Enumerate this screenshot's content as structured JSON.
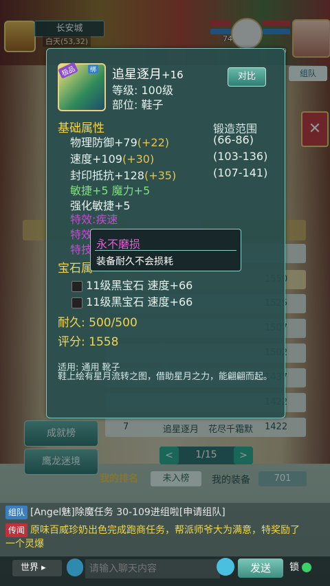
{
  "hud": {
    "city": "长安城",
    "time_coords": "白天(53,32)",
    "pet_level": "74",
    "player_level_partial": "9",
    "team_button": "组队"
  },
  "item": {
    "badge_left": "极品",
    "badge_right": "绑",
    "name": "追星逐月",
    "enhance": "+16",
    "level": "等级: 100级",
    "slot": "部位: 鞋子",
    "compare_button": "对比",
    "base_header": "基础属性",
    "forge_header": "锻造范围",
    "stats": [
      {
        "label": "物理防御+79",
        "bonus": "(+22)",
        "range": "(66-86)"
      },
      {
        "label": "速度+109",
        "bonus": "(+30)",
        "range": "(103-136)"
      },
      {
        "label": "封印抵抗+128",
        "bonus": "(+35)",
        "range": "(107-141)"
      }
    ],
    "green_line": "敏捷+5 魔力+5",
    "strengthen": "强化敏捷+5",
    "effect1": "特效:疾速",
    "effect2_partial": "特效",
    "effect3_partial": "特技",
    "gem_header": "宝石属",
    "gems": [
      "11级黑宝石 速度+66",
      "11级黑宝石 速度+66"
    ],
    "durability": "耐久: 500/500",
    "score": "评分: 1558",
    "apply": "适用: 通用 靴子",
    "desc": "鞋上绘有星月流转之图，借助星月之力，能翩翩而起。"
  },
  "tooltip": {
    "title": "永不磨损",
    "body": "装备耐久不会损耗"
  },
  "ranking": {
    "rows": [
      {
        "score": "1550"
      },
      {
        "score": "1525"
      },
      {
        "score": "1507"
      },
      {
        "score": "1502"
      },
      {
        "score": "1437"
      },
      {
        "score": "1422"
      }
    ],
    "last_row": {
      "rank": "7",
      "item": "追星逐月",
      "owner": "花尽千霜默",
      "score": "1422"
    },
    "side_buttons": [
      "成就榜",
      "鹰龙迷境"
    ],
    "page": "1/15",
    "my_rank_label": "我的排名",
    "not_ranked": "未入榜",
    "my_equip_label": "我的装备",
    "my_equip_value": "701"
  },
  "chat": {
    "lines": [
      {
        "tag": "组队",
        "tag_color": "#3a7fc0",
        "text": "[Angel魅]除魔任务 30-109进组啦[申请组队]"
      },
      {
        "tag": "传闻",
        "tag_color": "#c0303a",
        "text": "原味百威珍奶出色完成跑商任务，帮派师爷大为满意，特奖励了一个灵爆"
      }
    ],
    "channel": "世界",
    "input_placeholder": "请输入聊天内容",
    "send_button": "发送",
    "lock_label": "锁"
  }
}
